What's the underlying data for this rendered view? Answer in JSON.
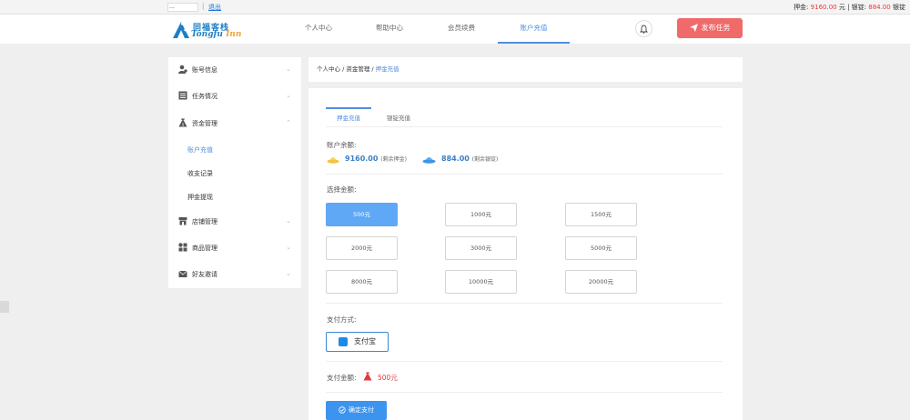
{
  "topbar": {
    "user": "…",
    "sep": "|",
    "logout": "退出",
    "deposit_label": "押金:",
    "deposit_value": "9160.00",
    "deposit_unit": "元",
    "ingot_label": "银锭:",
    "ingot_value": "884.00",
    "ingot_unit": "银锭"
  },
  "header": {
    "logo_cn": "同福客栈",
    "logo_en_1": "Tongfu ",
    "logo_en_2": "Inn",
    "nav": [
      "个人中心",
      "帮助中心",
      "会员续费",
      "账户充值"
    ],
    "publish": "发布任务"
  },
  "sidebar": {
    "items": [
      {
        "label": "账号信息",
        "chev": "⌄",
        "icon": "user-icon"
      },
      {
        "label": "任务情况",
        "chev": "⌄",
        "icon": "task-list-icon"
      },
      {
        "label": "资金管理",
        "chev": "⌃",
        "icon": "money-bag-icon"
      },
      {
        "label": "店铺管理",
        "chev": "⌄",
        "icon": "store-icon"
      },
      {
        "label": "商品管理",
        "chev": "⌄",
        "icon": "grid-icon"
      },
      {
        "label": "好友邀请",
        "chev": "⌄",
        "icon": "mail-icon"
      }
    ],
    "sub": [
      "账户充值",
      "收支记录",
      "押金提现"
    ]
  },
  "breadcrumb": {
    "a": "个人中心",
    "b": "资金管理",
    "c": "押金充值",
    "sep": " / "
  },
  "main": {
    "tabs": [
      "押金充值",
      "银锭充值"
    ],
    "balance_title": "账户余额:",
    "deposit_value": "9160.00",
    "deposit_note": "(剩余押金)",
    "ingot_value": "884.00",
    "ingot_note": "(剩余银锭)",
    "choose_title": "选择金额:",
    "amounts": [
      "500元",
      "1000元",
      "1500元",
      "2000元",
      "3000元",
      "5000元",
      "8000元",
      "10000元",
      "20000元"
    ],
    "selected_amount": "500元",
    "pay_method_title": "支付方式:",
    "pay_method": "支付宝",
    "pay_amount_label": "支付金额:",
    "pay_amount_value": "500元",
    "confirm": "确定支付"
  },
  "colors": {
    "accent": "#4f8ee0",
    "publish": "#f06a6a",
    "red": "#e4393c",
    "selected": "#5fa8f6"
  }
}
